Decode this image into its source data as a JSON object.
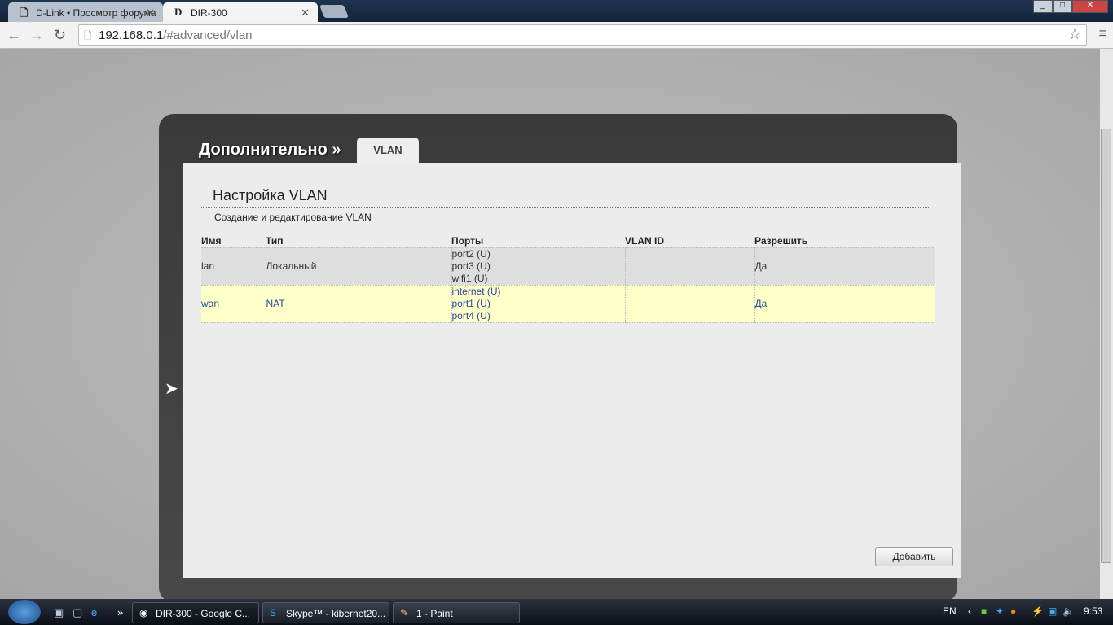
{
  "browser": {
    "tabs": [
      {
        "label": "D-Link • Просмотр форума",
        "favicon": "page-icon"
      },
      {
        "label": "DIR-300",
        "favicon": "dlink-icon"
      }
    ],
    "url_host": "192.168.0.1",
    "url_path": "/#advanced/vlan"
  },
  "page": {
    "breadcrumb": "Дополнительно »",
    "tab": "VLAN",
    "title": "Настройка VLAN",
    "subtitle": "Создание и редактирование VLAN",
    "table": {
      "headers": [
        "Имя",
        "Тип",
        "Порты",
        "VLAN ID",
        "Разрешить"
      ],
      "rows": [
        {
          "name": "lan",
          "type": "Локальный",
          "ports": [
            "port2 (U)",
            "port3 (U)",
            "wifi1 (U)"
          ],
          "vlan_id": "",
          "enabled": "Да"
        },
        {
          "name": "wan",
          "type": "NAT",
          "ports": [
            "internet (U)",
            "port1 (U)",
            "port4 (U)"
          ],
          "vlan_id": "",
          "enabled": "Да"
        }
      ]
    },
    "add_button": "Добавить"
  },
  "taskbar": {
    "items": [
      "DIR-300 - Google C...",
      "Skype™ - kibernet20...",
      "1 - Paint"
    ],
    "lang": "EN",
    "time": "9:53"
  }
}
